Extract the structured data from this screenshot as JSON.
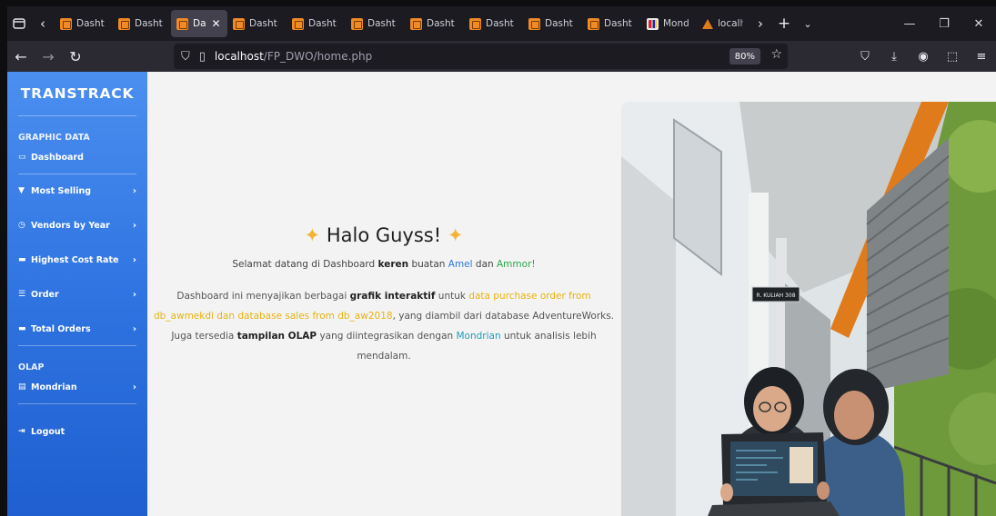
{
  "browser": {
    "tabs": [
      {
        "label": "Dasht",
        "icon": "xampp"
      },
      {
        "label": "Dasht",
        "icon": "xampp"
      },
      {
        "label": "Da",
        "icon": "xampp",
        "active": true
      },
      {
        "label": "Dasht",
        "icon": "xampp"
      },
      {
        "label": "Dasht",
        "icon": "xampp"
      },
      {
        "label": "Dasht",
        "icon": "xampp"
      },
      {
        "label": "Dasht",
        "icon": "xampp"
      },
      {
        "label": "Dasht",
        "icon": "xampp"
      },
      {
        "label": "Dasht",
        "icon": "xampp"
      },
      {
        "label": "Dasht",
        "icon": "xampp"
      },
      {
        "label": "Mond",
        "icon": "mondrian"
      },
      {
        "label": "localh",
        "icon": "apache"
      }
    ],
    "url_host": "localhost",
    "url_path": "/FP_DWO/home.php",
    "zoom": "80%"
  },
  "sidebar": {
    "brand": "TRANSTRACK",
    "section_graphic": "GRAPHIC DATA",
    "items": [
      {
        "label": "Dashboard",
        "icon": "monitor-icon",
        "chevron": false
      },
      {
        "label": "Most Selling",
        "icon": "cart-icon",
        "chevron": true
      },
      {
        "label": "Vendors by Year",
        "icon": "clock-icon",
        "chevron": true
      },
      {
        "label": "Highest Cost Rate",
        "icon": "ticket-icon",
        "chevron": true
      },
      {
        "label": "Order",
        "icon": "list-icon",
        "chevron": true
      },
      {
        "label": "Total Orders",
        "icon": "ticket-icon",
        "chevron": true
      }
    ],
    "section_olap": "OLAP",
    "olap_item": {
      "label": "Mondrian",
      "icon": "database-icon"
    },
    "logout": "Logout"
  },
  "hero": {
    "title": "Halo Guyss!",
    "lead": {
      "p1": "Selamat datang di Dashboard ",
      "bold": "keren",
      "p2": " buatan ",
      "name1": "Amel",
      "p3": " dan ",
      "name2": "Ammor!"
    },
    "desc": {
      "p1": "Dashboard ini menyajikan berbagai ",
      "b1": "grafik interaktif",
      "p2": " untuk ",
      "hl": "data purchase order from db_awmekdi dan database sales from db_aw2018",
      "p3": ", yang diambil dari database AdventureWorks. Juga tersedia ",
      "b2": "tampilan OLAP",
      "p4": " yang diintegrasikan dengan ",
      "link": "Mondrian",
      "p5": " untuk analisis lebih mendalam."
    }
  },
  "photo": {
    "sign": "R. KULIAH 308"
  },
  "colors": {
    "sidebar_top": "#4b8ff0",
    "sidebar_bottom": "#1f5fcf",
    "accent_yellow": "#e8b30c",
    "accent_blue": "#2c7bdc",
    "accent_green": "#2aa64e",
    "accent_teal": "#1f9fb7"
  }
}
